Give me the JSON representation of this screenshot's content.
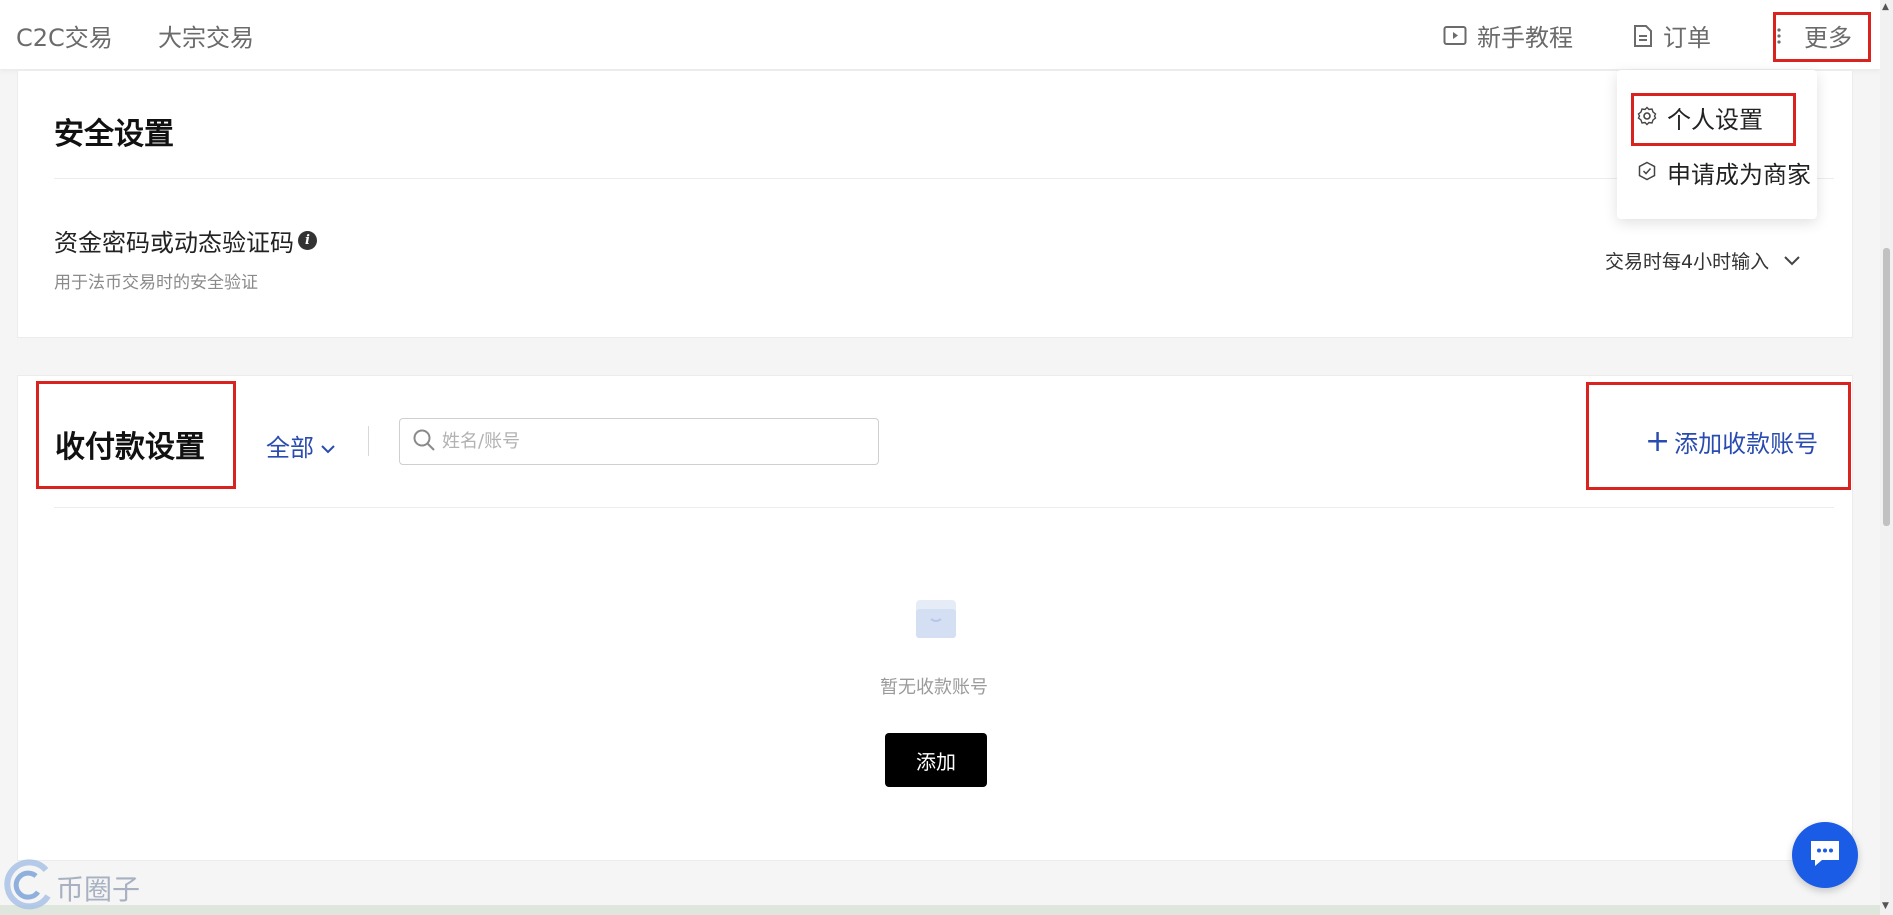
{
  "topbar": {
    "nav_c2c": "C2C交易",
    "nav_bulk": "大宗交易",
    "tutorial_label": "新手教程",
    "orders_label": "订单",
    "more_label": "更多"
  },
  "more_menu": {
    "items": [
      {
        "label": "个人设置",
        "icon": "gear-icon"
      },
      {
        "label": "申请成为商家",
        "icon": "shield-check-icon"
      }
    ]
  },
  "security": {
    "title": "安全设置",
    "fund_password_label": "资金密码或动态验证码",
    "fund_password_hint": "用于法币交易时的安全验证",
    "frequency_value": "交易时每4小时输入"
  },
  "payment": {
    "title": "收付款设置",
    "filter_value": "全部",
    "search_placeholder": "姓名/账号",
    "add_account_label": "添加收款账号",
    "empty_text": "暂无收款账号",
    "add_button_label": "添加"
  },
  "watermark": {
    "text": "币圈子"
  },
  "colors": {
    "accent_blue": "#2a4bb0",
    "highlight_red": "#d8231f",
    "chat_blue": "#1a5ce5"
  }
}
